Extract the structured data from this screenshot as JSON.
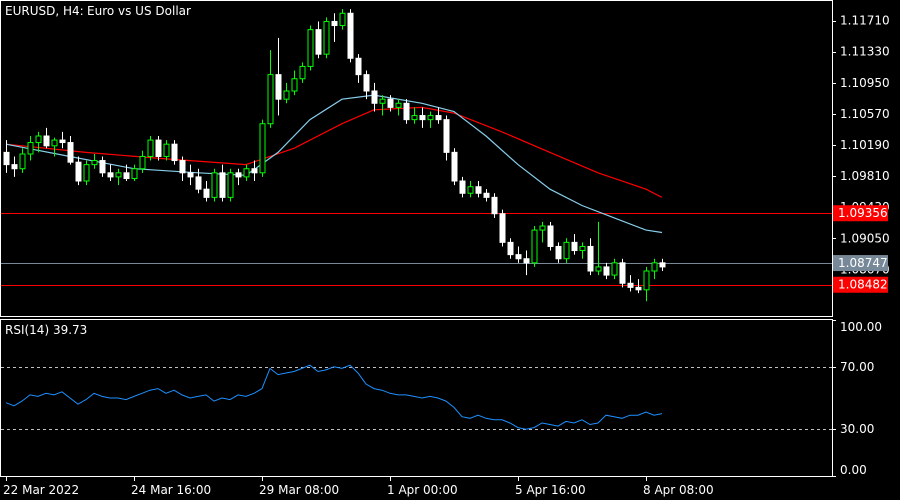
{
  "header": {
    "symbol": "EURUSD, H4:",
    "description": "Euro vs US Dollar"
  },
  "colors": {
    "background": "#000000",
    "frame": "#ffffff",
    "bull_candle": "#00ff00",
    "bear_candle": "#ffffff",
    "ma_fast": "#87ceeb",
    "ma_slow": "#ff0000",
    "level_line": "#ff0000",
    "bid_line": "#778899",
    "rsi_line": "#1e90ff",
    "rsi_levels": "#c0c0c0"
  },
  "chart_data": [
    {
      "type": "candlestick",
      "name": "price",
      "ylim": [
        1.081,
        1.1195
      ],
      "y_ticks": [
        "1.11710",
        "1.11330",
        "1.10950",
        "1.10570",
        "1.10190",
        "1.09810",
        "1.09430",
        "1.09050",
        "1.08670"
      ],
      "x_tick_labels": [
        "22 Mar 2022",
        "24 Mar 16:00",
        "29 Mar 08:00",
        "1 Apr 00:00",
        "5 Apr 16:00",
        "8 Apr 08:00"
      ],
      "x_tick_bar_index": [
        0,
        16,
        32,
        48,
        64,
        80
      ],
      "bars_total": 83,
      "candles": [
        [
          1.101,
          1.1025,
          1.0985,
          1.0995
        ],
        [
          1.0995,
          1.1005,
          1.098,
          1.099
        ],
        [
          1.099,
          1.1015,
          1.0985,
          1.1008
        ],
        [
          1.1008,
          1.103,
          1.1,
          1.1022
        ],
        [
          1.1022,
          1.1035,
          1.101,
          1.103
        ],
        [
          1.103,
          1.104,
          1.1015,
          1.1018
        ],
        [
          1.1018,
          1.1028,
          1.1005,
          1.1025
        ],
        [
          1.1025,
          1.1035,
          1.1015,
          1.1022
        ],
        [
          1.1022,
          1.103,
          1.0995,
          1.0998
        ],
        [
          1.0998,
          1.1005,
          1.097,
          1.0975
        ],
        [
          1.0975,
          1.1,
          1.097,
          1.0995
        ],
        [
          1.0995,
          1.1008,
          1.099,
          1.1
        ],
        [
          1.1,
          1.1005,
          1.098,
          1.0985
        ],
        [
          1.0985,
          1.0995,
          1.0975,
          1.098
        ],
        [
          1.098,
          1.099,
          1.097,
          1.0985
        ],
        [
          1.0985,
          1.0995,
          1.0975,
          1.0978
        ],
        [
          1.0978,
          1.0995,
          1.0975,
          1.099
        ],
        [
          1.099,
          1.1012,
          1.0985,
          1.1005
        ],
        [
          1.1005,
          1.103,
          1.1,
          1.1025
        ],
        [
          1.1025,
          1.103,
          1.1,
          1.1005
        ],
        [
          1.1005,
          1.1025,
          1.1,
          1.102
        ],
        [
          1.102,
          1.1025,
          1.0995,
          1.1
        ],
        [
          1.1,
          1.1005,
          1.0975,
          1.0985
        ],
        [
          1.0985,
          1.0995,
          1.097,
          1.098
        ],
        [
          1.098,
          1.099,
          1.096,
          1.0965
        ],
        [
          1.0965,
          1.0975,
          1.095,
          1.0955
        ],
        [
          1.0955,
          1.099,
          1.095,
          1.0985
        ],
        [
          1.0985,
          1.0995,
          1.095,
          1.0955
        ],
        [
          1.0955,
          1.099,
          1.095,
          1.0985
        ],
        [
          1.0985,
          1.099,
          1.097,
          1.098
        ],
        [
          1.098,
          1.0995,
          1.0975,
          1.099
        ],
        [
          1.099,
          1.1,
          1.0975,
          1.0985
        ],
        [
          1.0985,
          1.105,
          1.098,
          1.1045
        ],
        [
          1.1045,
          1.1135,
          1.104,
          1.1105
        ],
        [
          1.1105,
          1.115,
          1.1055,
          1.1075
        ],
        [
          1.1075,
          1.1095,
          1.107,
          1.1085
        ],
        [
          1.1085,
          1.111,
          1.108,
          1.11
        ],
        [
          1.11,
          1.112,
          1.1095,
          1.1115
        ],
        [
          1.1115,
          1.1165,
          1.111,
          1.116
        ],
        [
          1.116,
          1.117,
          1.1125,
          1.113
        ],
        [
          1.113,
          1.1175,
          1.1125,
          1.117
        ],
        [
          1.117,
          1.118,
          1.1145,
          1.1165
        ],
        [
          1.1165,
          1.1185,
          1.116,
          1.118
        ],
        [
          1.118,
          1.1185,
          1.112,
          1.1125
        ],
        [
          1.1125,
          1.113,
          1.1095,
          1.1105
        ],
        [
          1.1105,
          1.111,
          1.1075,
          1.1085
        ],
        [
          1.1085,
          1.1095,
          1.106,
          1.107
        ],
        [
          1.107,
          1.108,
          1.1055,
          1.1075
        ],
        [
          1.1075,
          1.108,
          1.106,
          1.1065
        ],
        [
          1.1065,
          1.1075,
          1.1055,
          1.107
        ],
        [
          1.107,
          1.1075,
          1.1045,
          1.105
        ],
        [
          1.105,
          1.1065,
          1.1045,
          1.1055
        ],
        [
          1.1055,
          1.1065,
          1.104,
          1.105
        ],
        [
          1.105,
          1.106,
          1.104,
          1.1055
        ],
        [
          1.1055,
          1.1065,
          1.1045,
          1.105
        ],
        [
          1.105,
          1.1055,
          1.1,
          1.101
        ],
        [
          1.101,
          1.1015,
          1.097,
          1.0975
        ],
        [
          1.0975,
          1.098,
          1.0955,
          1.096
        ],
        [
          1.096,
          1.0975,
          1.0955,
          1.0968
        ],
        [
          1.0968,
          1.0975,
          1.0955,
          1.096
        ],
        [
          1.096,
          1.0965,
          1.095,
          1.0955
        ],
        [
          1.0955,
          1.096,
          1.093,
          1.0935
        ],
        [
          1.0935,
          1.094,
          1.0895,
          1.09
        ],
        [
          1.09,
          1.0905,
          1.088,
          1.0885
        ],
        [
          1.0885,
          1.0895,
          1.0875,
          1.088
        ],
        [
          1.088,
          1.089,
          1.086,
          1.0875
        ],
        [
          1.0875,
          1.092,
          1.087,
          1.0915
        ],
        [
          1.0915,
          1.0925,
          1.09,
          1.092
        ],
        [
          1.092,
          1.0925,
          1.089,
          1.0895
        ],
        [
          1.0895,
          1.09,
          1.0875,
          1.088
        ],
        [
          1.088,
          1.0905,
          1.0875,
          1.09
        ],
        [
          1.09,
          1.091,
          1.0885,
          1.089
        ],
        [
          1.089,
          1.09,
          1.088,
          1.0895
        ],
        [
          1.0895,
          1.0905,
          1.086,
          1.0865
        ],
        [
          1.0865,
          1.0925,
          1.086,
          1.087
        ],
        [
          1.087,
          1.0875,
          1.0855,
          1.086
        ],
        [
          1.086,
          1.088,
          1.0855,
          1.0875
        ],
        [
          1.0875,
          1.088,
          1.0845,
          1.085
        ],
        [
          1.085,
          1.086,
          1.084,
          1.0845
        ],
        [
          1.0845,
          1.0855,
          1.0838,
          1.0842
        ],
        [
          1.0842,
          1.087,
          1.0828,
          1.0865
        ],
        [
          1.0865,
          1.088,
          1.0855,
          1.0875
        ],
        [
          1.0875,
          1.088,
          1.0865,
          1.087
        ]
      ],
      "ma_fast": [
        [
          0,
          1.102
        ],
        [
          8,
          1.1005
        ],
        [
          16,
          1.099
        ],
        [
          24,
          1.0985
        ],
        [
          30,
          1.0982
        ],
        [
          34,
          1.101
        ],
        [
          38,
          1.105
        ],
        [
          42,
          1.1075
        ],
        [
          46,
          1.108
        ],
        [
          52,
          1.107
        ],
        [
          56,
          1.106
        ],
        [
          60,
          1.103
        ],
        [
          64,
          1.0995
        ],
        [
          68,
          1.0965
        ],
        [
          72,
          1.0945
        ],
        [
          76,
          1.093
        ],
        [
          80,
          1.0915
        ],
        [
          82,
          1.0912
        ]
      ],
      "ma_slow": [
        [
          0,
          1.102
        ],
        [
          10,
          1.101
        ],
        [
          20,
          1.1002
        ],
        [
          30,
          1.0995
        ],
        [
          36,
          1.1015
        ],
        [
          42,
          1.1045
        ],
        [
          46,
          1.1062
        ],
        [
          52,
          1.1065
        ],
        [
          56,
          1.1058
        ],
        [
          62,
          1.1035
        ],
        [
          68,
          1.101
        ],
        [
          74,
          1.0985
        ],
        [
          80,
          1.0965
        ],
        [
          82,
          1.0955
        ]
      ],
      "levels": [
        {
          "value": 1.09356,
          "label": "1.09356"
        },
        {
          "value": 1.08482,
          "label": "1.08482"
        }
      ],
      "bid": {
        "value": 1.08747,
        "label": "1.08747"
      }
    },
    {
      "type": "line",
      "name": "rsi",
      "label": "RSI(14) 39.73",
      "ylim": [
        0,
        100
      ],
      "y_ticks": [
        "100.00",
        "70.00",
        "30.00",
        "0.00"
      ],
      "levels": [
        70,
        30
      ],
      "values": [
        47,
        45,
        48,
        52,
        51,
        53,
        52,
        54,
        50,
        46,
        49,
        53,
        51,
        50,
        50,
        49,
        51,
        53,
        55,
        56,
        53,
        55,
        52,
        50,
        51,
        52,
        48,
        50,
        49,
        52,
        51,
        53,
        56,
        69,
        65,
        66,
        67,
        69,
        71,
        67,
        68,
        70,
        69,
        71,
        66,
        59,
        56,
        55,
        53,
        52,
        52,
        51,
        50,
        51,
        50,
        48,
        44,
        38,
        37,
        39,
        37,
        36,
        36,
        34,
        31,
        30,
        31,
        34,
        33,
        32,
        35,
        34,
        36,
        33,
        34,
        39,
        38,
        37,
        39,
        39,
        41,
        39,
        40
      ]
    }
  ]
}
